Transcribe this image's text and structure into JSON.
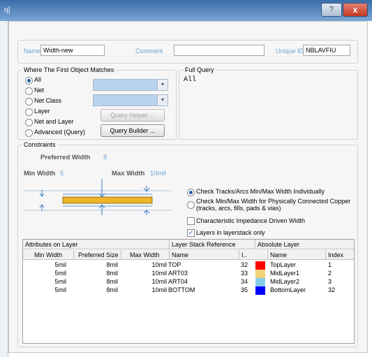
{
  "window": {
    "title_fragment": "ŋ]",
    "help_label": "?",
    "close_label": "x"
  },
  "header": {
    "name_label": "Name",
    "name_value": "Width-new",
    "comment_label": "Comment",
    "comment_value": "",
    "uid_label": "Unique ID",
    "uid_value": "NBLAVFIU"
  },
  "match": {
    "title": "Where The First Object Matches",
    "options": [
      "All",
      "Net",
      "Net Class",
      "Layer",
      "Net and Layer",
      "Advanced (Query)"
    ],
    "selected": "All",
    "query_helper_label": "Query Helper ...",
    "query_builder_label": "Query Builder ..."
  },
  "full_query": {
    "title": "Full Query",
    "text": "All"
  },
  "constraints": {
    "title": "Constraints",
    "preferred_width_label": "Preferred Width",
    "preferred_width_value": "8",
    "min_width_label": "Min Width",
    "min_width_value": "5",
    "max_width_label": "Max Width",
    "max_width_value": "10mil",
    "radio_individually": "Check Tracks/Arcs Min/Max Width Individually",
    "radio_copper_line1": "Check Min/Max Width for Physically Connected Copper",
    "radio_copper_line2": "(tracks, arcs, fills, pads & vias)",
    "chk_impedance": "Characteristic Impedance Driven Width",
    "chk_layerstack": "Layers in layerstack only",
    "track_color": "#f0b42a"
  },
  "table": {
    "group_attributes": "Attributes on Layer",
    "group_stack": "Layer Stack Reference",
    "group_absolute": "Absolute Layer",
    "col_min": "Min Width",
    "col_pref": "Preferred Size",
    "col_max": "Max Width",
    "col_name": "Name",
    "col_idx": "I..",
    "col_abs_name": "Name",
    "col_index": "Index",
    "rows": [
      {
        "min": "5mil",
        "pref": "8mil",
        "max": "10mil",
        "name": "TOP",
        "idx": "32",
        "color": "#ff0000",
        "abs": "TopLayer",
        "index": "1"
      },
      {
        "min": "5mil",
        "pref": "8mil",
        "max": "10mil",
        "name": "ART03",
        "idx": "33",
        "color": "#f2d27a",
        "abs": "MidLayer1",
        "index": "2"
      },
      {
        "min": "5mil",
        "pref": "8mil",
        "max": "10mil",
        "name": "ART04",
        "idx": "34",
        "color": "#87ceeb",
        "abs": "MidLayer2",
        "index": "3"
      },
      {
        "min": "5mil",
        "pref": "8mil",
        "max": "10mil",
        "name": "BOTTOM",
        "idx": "35",
        "color": "#0000ff",
        "abs": "BottomLayer",
        "index": "32"
      }
    ]
  }
}
